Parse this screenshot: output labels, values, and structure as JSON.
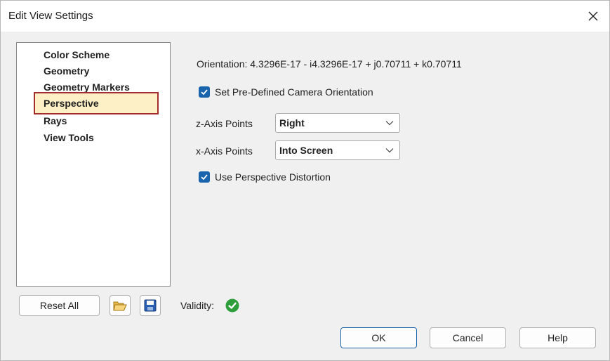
{
  "window": {
    "title": "Edit View Settings"
  },
  "nav": {
    "items": [
      {
        "label": "Color Scheme"
      },
      {
        "label": "Geometry"
      },
      {
        "label": "Geometry Markers"
      },
      {
        "label": "Perspective"
      },
      {
        "label": "Rays"
      },
      {
        "label": "View Tools"
      }
    ],
    "selected": "Perspective"
  },
  "perspective": {
    "orientation_text": "Orientation: 4.3296E-17 - i4.3296E-17 + j0.70711 + k0.70711",
    "set_camera": {
      "label": "Set Pre-Defined Camera Orientation",
      "checked": true
    },
    "z_axis": {
      "label": "z-Axis Points",
      "value": "Right"
    },
    "x_axis": {
      "label": "x-Axis Points",
      "value": "Into Screen"
    },
    "use_distortion": {
      "label": "Use Perspective Distortion",
      "checked": true
    }
  },
  "footer": {
    "reset_label": "Reset All",
    "validity_label": "Validity:",
    "ok_label": "OK",
    "cancel_label": "Cancel",
    "help_label": "Help"
  },
  "colors": {
    "checkbox_fill": "#1a64ad",
    "selection_bg": "#fdf0c6",
    "selection_border": "#a32c2c",
    "validity_ok": "#2e9e3a"
  },
  "icons": [
    "close-icon",
    "checkmark-icon",
    "chevron-down-icon",
    "open-folder-icon",
    "save-disk-icon",
    "validity-check-icon"
  ]
}
